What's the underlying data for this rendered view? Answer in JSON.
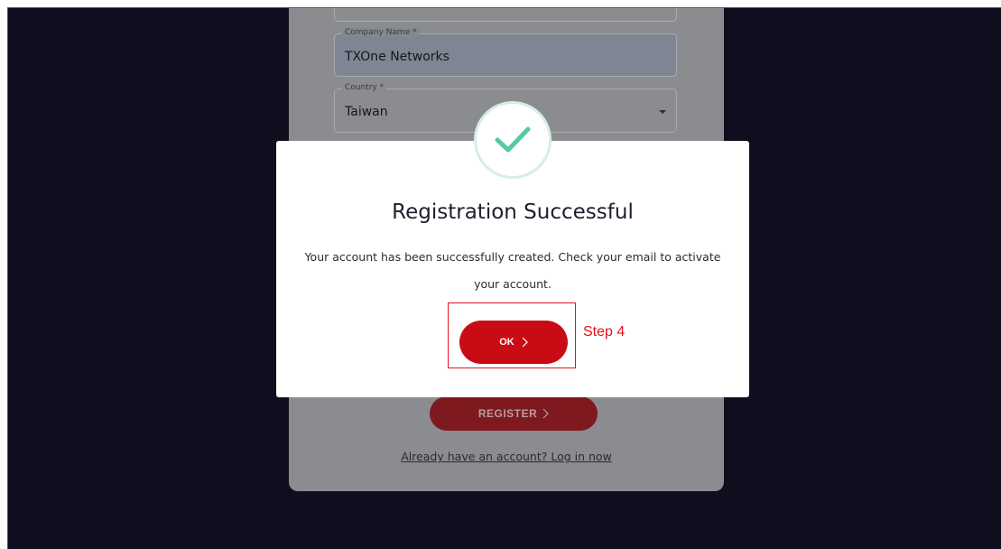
{
  "form": {
    "company_label": "Company Name *",
    "company_value": "TXOne Networks",
    "country_label": "Country *",
    "country_value": "Taiwan",
    "register_label": "REGISTER",
    "login_link": "Already have an account? Log in now"
  },
  "modal": {
    "title": "Registration Successful",
    "message": "Your account has been successfully created. Check your email to activate your account.",
    "ok_label": "OK",
    "icon": "checkmark-icon",
    "accent_color": "#57c9a6"
  },
  "annotation": {
    "step_label": "Step 4",
    "color": "#e3111b"
  },
  "colors": {
    "backdrop": "#0f0d1e",
    "primary": "#c90b15"
  }
}
